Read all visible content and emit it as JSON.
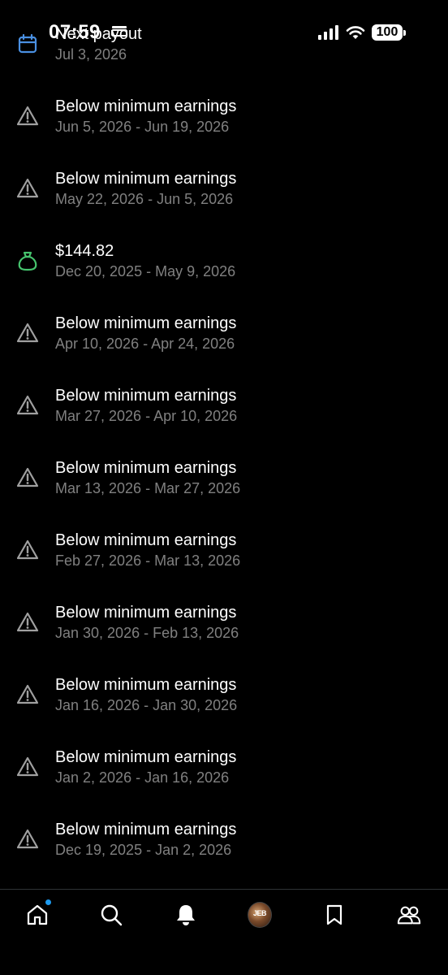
{
  "status_bar": {
    "time": "07:59",
    "battery": "100"
  },
  "payouts": [
    {
      "icon": "calendar-icon",
      "title": "Next payout",
      "subtitle": "Jul 3, 2026"
    },
    {
      "icon": "warning-icon",
      "title": "Below minimum earnings",
      "subtitle": "Jun 5, 2026 - Jun 19, 2026"
    },
    {
      "icon": "warning-icon",
      "title": "Below minimum earnings",
      "subtitle": "May 22, 2026 - Jun 5, 2026"
    },
    {
      "icon": "money-bag-icon",
      "title": "$144.82",
      "subtitle": "Dec 20, 2025 - May 9, 2026"
    },
    {
      "icon": "warning-icon",
      "title": "Below minimum earnings",
      "subtitle": "Apr 10, 2026 - Apr 24, 2026"
    },
    {
      "icon": "warning-icon",
      "title": "Below minimum earnings",
      "subtitle": "Mar 27, 2026 - Apr 10, 2026"
    },
    {
      "icon": "warning-icon",
      "title": "Below minimum earnings",
      "subtitle": "Mar 13, 2026 - Mar 27, 2026"
    },
    {
      "icon": "warning-icon",
      "title": "Below minimum earnings",
      "subtitle": "Feb 27, 2026 - Mar 13, 2026"
    },
    {
      "icon": "warning-icon",
      "title": "Below minimum earnings",
      "subtitle": "Jan 30, 2026 - Feb 13, 2026"
    },
    {
      "icon": "warning-icon",
      "title": "Below minimum earnings",
      "subtitle": "Jan 16, 2026 - Jan 30, 2026"
    },
    {
      "icon": "warning-icon",
      "title": "Below minimum earnings",
      "subtitle": "Jan 2, 2026 - Jan 16, 2026"
    },
    {
      "icon": "warning-icon",
      "title": "Below minimum earnings",
      "subtitle": "Dec 19, 2025 - Jan 2, 2026"
    }
  ],
  "nav": {
    "items": [
      "home",
      "search",
      "notifications",
      "profile",
      "bookmarks",
      "communities"
    ],
    "avatar_text": "JEB"
  },
  "colors": {
    "background": "#000000",
    "primary_text": "#ffffff",
    "secondary_text": "#808080",
    "calendar_icon": "#4a90e2",
    "money_icon": "#46c46e",
    "warning_icon": "#a0a0a0",
    "notification_dot": "#1d9bf0"
  }
}
